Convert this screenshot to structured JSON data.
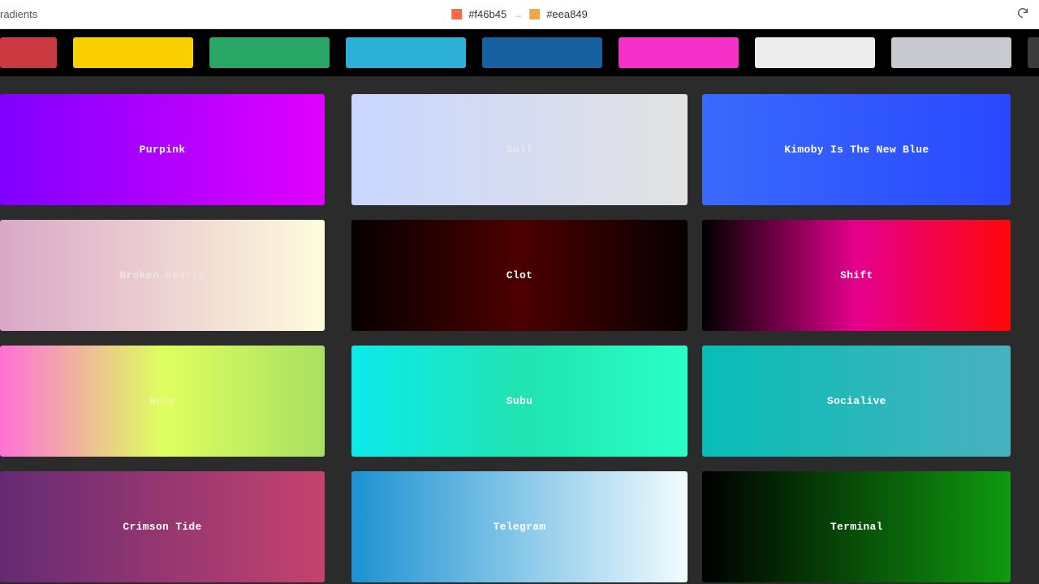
{
  "topbar": {
    "left_text": "radients",
    "hex_from": "#f46b45",
    "hex_to": "#eea849",
    "swatch_from": "#f46b45",
    "swatch_to": "#eea849",
    "separator": "→"
  },
  "strip": [
    {
      "color": "#c9393f"
    },
    {
      "color": "#f9cf00"
    },
    {
      "color": "#2aa767"
    },
    {
      "color": "#2db0d8"
    },
    {
      "color": "#1760a0"
    },
    {
      "color": "#f531c9"
    },
    {
      "color": "#ececec"
    },
    {
      "color": "#c9c9d0"
    },
    {
      "color": "#3a3a3a"
    }
  ],
  "gradients": [
    {
      "name": "Purpink",
      "css": "linear-gradient(90deg,#7f00ff,#e100ff)"
    },
    {
      "name": "Dull",
      "css": "linear-gradient(90deg,#c9d6ff,#e2e2e2)",
      "text": "#e8e8ee"
    },
    {
      "name": "Kimoby Is The New Blue",
      "css": "linear-gradient(90deg,#396afc,#2948ff)"
    },
    {
      "name": "Broken Hearts",
      "css": "linear-gradient(90deg,#d9a7c7,#fffcdc)",
      "text": "#f0e5de"
    },
    {
      "name": "Clot",
      "css": "linear-gradient(90deg,#070000,#4c0001,#070000)"
    },
    {
      "name": "Shift",
      "css": "linear-gradient(90deg,#000000,#e5008d,#ff070b)"
    },
    {
      "name": "Holy",
      "css": "linear-gradient(90deg,#ff6fd8,#dfff5e,#a8e063)",
      "text": "#f6f3a6"
    },
    {
      "name": "Subu",
      "css": "linear-gradient(90deg,#0cebeb,#20e3b2,#29ffc6)"
    },
    {
      "name": "Socialive",
      "css": "linear-gradient(90deg,#06beb6,#48b1bf)"
    },
    {
      "name": "Crimson Tide",
      "css": "linear-gradient(90deg,#642b73,#c6426e)"
    },
    {
      "name": "Telegram",
      "css": "linear-gradient(90deg,#1c92d2,#f2fcfe)"
    },
    {
      "name": "Terminal",
      "css": "linear-gradient(90deg,#000000,#0f9b0f)"
    }
  ]
}
